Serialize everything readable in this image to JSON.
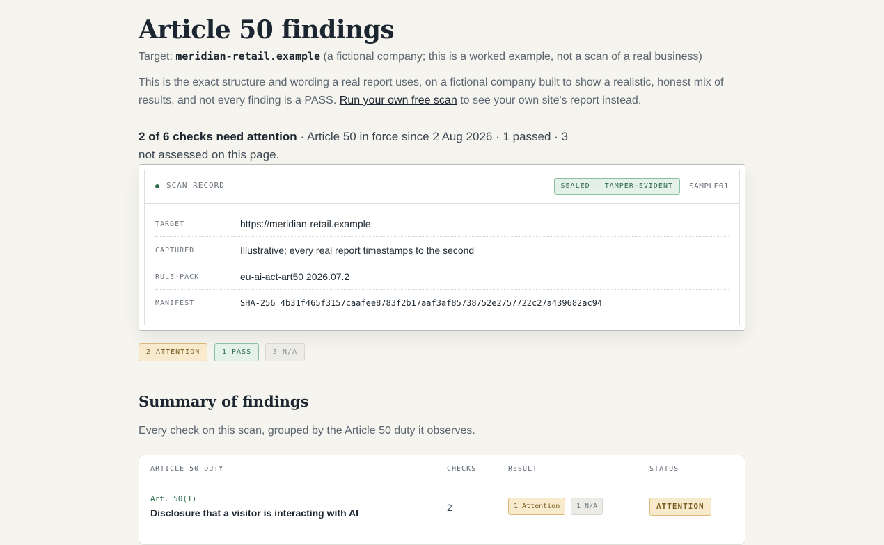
{
  "header": {
    "title": "Article 50 findings",
    "target_prefix": "Target:",
    "target_domain": "meridian-retail.example",
    "target_note": "(a fictional company; this is a worked example, not a scan of a real business)"
  },
  "intro": {
    "text": "This is the exact structure and wording a real report uses, on a fictional company built to show a realistic, honest mix of results, and not every finding is a PASS.",
    "link": "Run your own free scan",
    "after_link": "to see your own site's report instead."
  },
  "verdict": {
    "headline": "2 of 6 checks need attention",
    "detail": "· Article 50 in force since 2 Aug 2026 · 1 passed · 3 not assessed on this page."
  },
  "scan_record": {
    "label": "SCAN RECORD",
    "seal": "SEALED · TAMPER-EVIDENT",
    "id": "SAMPLE01",
    "rows": [
      {
        "key": "TARGET",
        "value": "https://meridian-retail.example"
      },
      {
        "key": "CAPTURED",
        "value": "Illustrative; every real report timestamps to the second"
      },
      {
        "key": "RULE-PACK",
        "value": "eu-ai-act-art50 2026.07.2"
      },
      {
        "key": "MANIFEST",
        "value": "SHA-256 4b31f465f3157caafee8783f2b17aaf3af85738752e2757722c27a439682ac94"
      }
    ]
  },
  "tally": {
    "attention": "2 ATTENTION",
    "pass": "1 PASS",
    "na": "3 N/A"
  },
  "summary": {
    "heading": "Summary of findings",
    "subtitle": "Every check on this scan, grouped by the Article 50 duty it observes.",
    "columns": [
      "ARTICLE 50 DUTY",
      "CHECKS",
      "RESULT",
      "STATUS"
    ],
    "rows": [
      {
        "ref": "Art. 50(1)",
        "duty": "Disclosure that a visitor is interacting with AI",
        "checks": "2",
        "result_attention": "1 Attention",
        "result_na": "1 N/A",
        "status": "ATTENTION"
      }
    ]
  },
  "colors": {
    "background": "#f5f4ee",
    "pass_green": "#2f6a4b",
    "attention_amber": "#7a5a1e"
  }
}
